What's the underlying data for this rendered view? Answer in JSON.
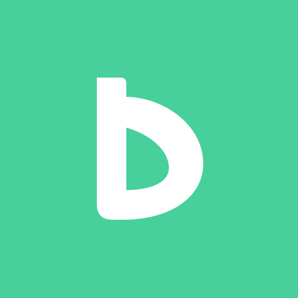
{
  "app_icon": {
    "icon_name": "b-logo-icon",
    "background_color": "#47CF9C",
    "glyph_color": "#FFFFFF"
  }
}
